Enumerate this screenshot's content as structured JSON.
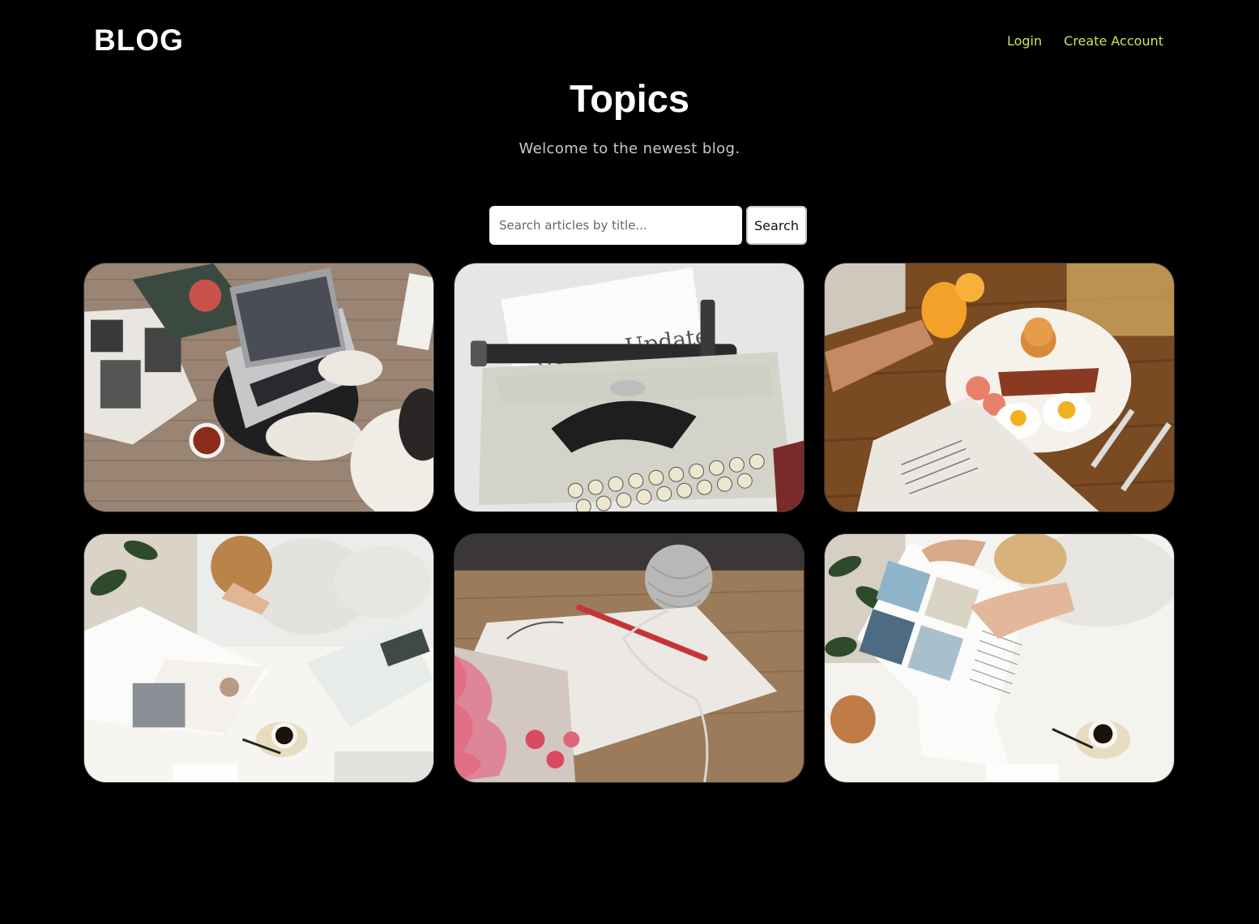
{
  "header": {
    "logo": "BLOG",
    "nav": {
      "login": "Login",
      "create_account": "Create Account"
    },
    "accent_color": "#d4e157"
  },
  "hero": {
    "title": "Topics",
    "subtitle": "Welcome to the newest blog."
  },
  "search": {
    "placeholder": "Search articles by title...",
    "value": "",
    "button_label": "Search"
  },
  "articles": [
    {
      "image": "person typing on laptop with magazine and tea",
      "photo_text": ""
    },
    {
      "image": "typewriter with paper",
      "photo_text": "Corona Update"
    },
    {
      "image": "breakfast plate with orange juice and newspaper",
      "photo_text": ""
    },
    {
      "image": "woman reading magazine with coffee",
      "photo_text": ""
    },
    {
      "image": "open book with yarn ball and crochet hook",
      "photo_text": ""
    },
    {
      "image": "hands flipping magazine pages beside coffee",
      "photo_text": ""
    }
  ]
}
